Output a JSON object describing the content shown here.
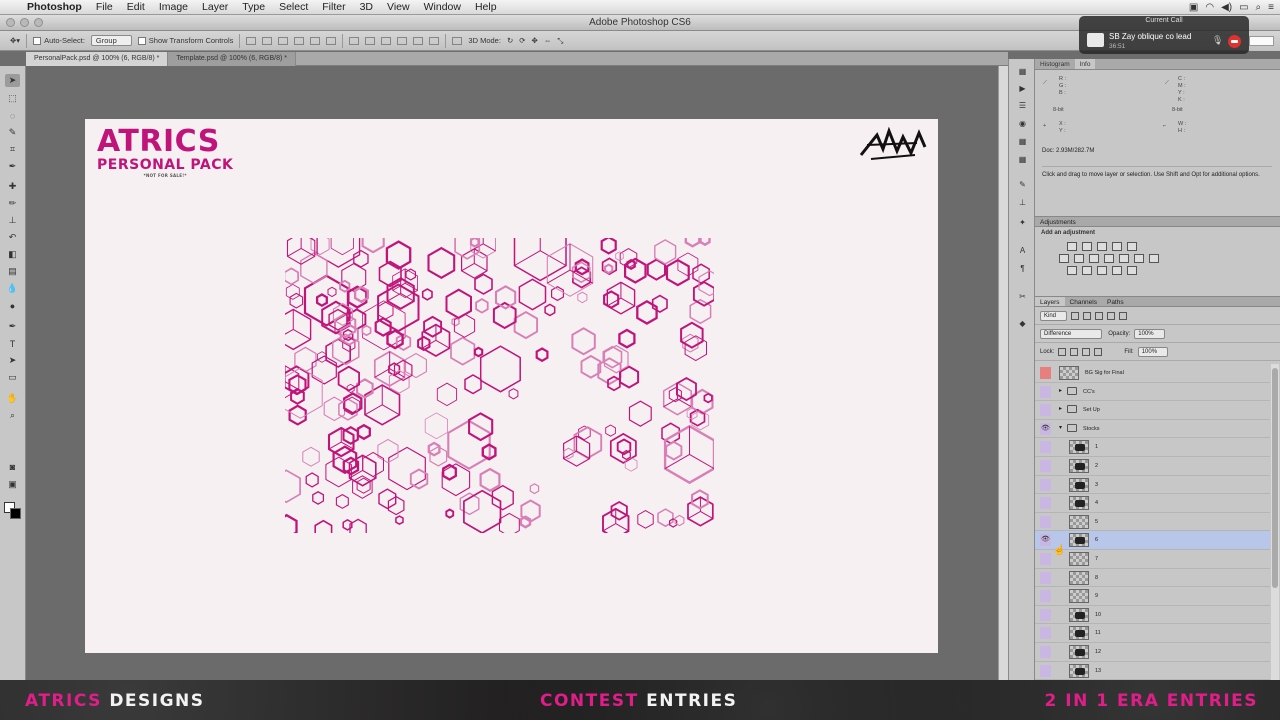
{
  "menubar": {
    "app": "Photoshop",
    "items": [
      "File",
      "Edit",
      "Image",
      "Layer",
      "Type",
      "Select",
      "Filter",
      "3D",
      "View",
      "Window",
      "Help"
    ]
  },
  "window": {
    "title": "Adobe Photoshop CS6"
  },
  "options_bar": {
    "auto_select_label": "Auto-Select:",
    "auto_select_value": "Group",
    "transform_label": "Show Transform Controls",
    "mode_label": "3D Mode:"
  },
  "doc_tabs": [
    {
      "label": "PersonalPack.psd @ 100% (6, RGB/8) *",
      "active": true
    },
    {
      "label": "Template.psd @ 100% (6, RGB/8) *",
      "active": false
    }
  ],
  "canvas": {
    "brand_title": "ATRICS",
    "brand_subtitle": "PERSONAL PACK",
    "brand_note": "*NOT FOR SALE!*",
    "accent_color": "#c0147a"
  },
  "panels": {
    "info_tabs": [
      "Histogram",
      "Info"
    ],
    "info_doc": "Doc: 2.93M/282.7M",
    "info_hint": "Click and drag to move layer or selection. Use Shift and Opt for additional options.",
    "info_labels": {
      "r": "R :",
      "g": "G :",
      "b": "B :",
      "c": "C :",
      "m": "M :",
      "y": "Y :",
      "k": "K :",
      "bit1": "8-bit",
      "bit2": "8-bit",
      "x": "X :",
      "yy": "Y :",
      "w": "W :",
      "h": "H :"
    },
    "adjustments_tab": "Adjustments",
    "adjustments_title": "Add an adjustment",
    "layers_tabs": [
      "Layers",
      "Channels",
      "Paths"
    ],
    "kind_label": "Kind",
    "blend_mode": "Difference",
    "opacity_label": "Opacity:",
    "opacity_value": "100%",
    "lock_label": "Lock:",
    "fill_label": "Fill:",
    "fill_value": "100%"
  },
  "layers": [
    {
      "name": "BG Sig for Final",
      "type": "layer",
      "visible": false,
      "red": true
    },
    {
      "name": "CC's",
      "type": "group",
      "visible": false
    },
    {
      "name": "Set Up",
      "type": "group",
      "visible": false
    },
    {
      "name": "Stocks",
      "type": "group-open",
      "visible": true
    },
    {
      "name": "1",
      "type": "layer",
      "visible": false
    },
    {
      "name": "2",
      "type": "layer",
      "visible": false
    },
    {
      "name": "3",
      "type": "layer",
      "visible": false
    },
    {
      "name": "4",
      "type": "layer",
      "visible": false
    },
    {
      "name": "5",
      "type": "layer",
      "visible": false
    },
    {
      "name": "6",
      "type": "layer",
      "visible": true,
      "selected": true
    },
    {
      "name": "7",
      "type": "layer",
      "visible": false
    },
    {
      "name": "8",
      "type": "layer",
      "visible": false
    },
    {
      "name": "9",
      "type": "layer",
      "visible": false
    },
    {
      "name": "10",
      "type": "layer",
      "visible": false
    },
    {
      "name": "11",
      "type": "layer",
      "visible": false
    },
    {
      "name": "12",
      "type": "layer",
      "visible": false
    },
    {
      "name": "13",
      "type": "layer",
      "visible": false
    }
  ],
  "call": {
    "title": "Current Call",
    "name": "SB Zay oblique co lead",
    "time": "36:51"
  },
  "footer": {
    "left_pink": "ATRICS",
    "left_white": "DESIGNS",
    "mid_pink": "CONTEST",
    "mid_white": "ENTRIES",
    "right_pink": "2 IN 1 ERA ENTRIES"
  }
}
